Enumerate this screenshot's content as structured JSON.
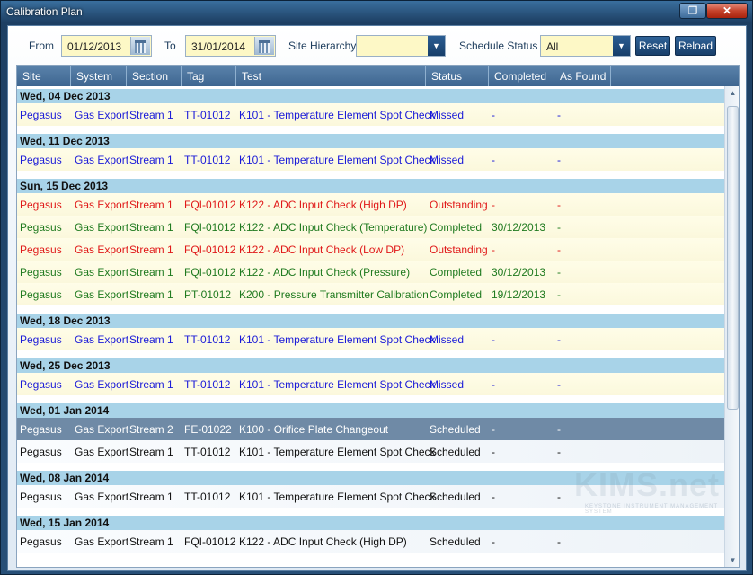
{
  "window": {
    "title": "Calibration Plan"
  },
  "filters": {
    "from_label": "From",
    "from_value": "01/12/2013",
    "to_label": "To",
    "to_value": "31/01/2014",
    "hierarchy_label": "Site Hierarchy",
    "hierarchy_value": "",
    "status_label": "Schedule Status",
    "status_value": "All",
    "reset_label": "Reset",
    "reload_label": "Reload"
  },
  "grid": {
    "columns": [
      "Site",
      "System",
      "Section",
      "Tag",
      "Test",
      "Status",
      "Completed",
      "As Found"
    ],
    "groups": [
      {
        "header": "Wed, 04 Dec 2013",
        "rows": [
          {
            "site": "Pegasus",
            "system": "Gas Export",
            "section": "Stream 1",
            "tag": "TT-01012",
            "test": "K101 - Temperature Element Spot Check",
            "status": "Missed",
            "completed": "-",
            "as_found": "-",
            "color": "#1a1ad8"
          }
        ]
      },
      {
        "header": "Wed, 11 Dec 2013",
        "rows": [
          {
            "site": "Pegasus",
            "system": "Gas Export",
            "section": "Stream 1",
            "tag": "TT-01012",
            "test": "K101 - Temperature Element Spot Check",
            "status": "Missed",
            "completed": "-",
            "as_found": "-",
            "color": "#1a1ad8"
          }
        ]
      },
      {
        "header": "Sun, 15 Dec 2013",
        "rows": [
          {
            "site": "Pegasus",
            "system": "Gas Export",
            "section": "Stream 1",
            "tag": "FQI-01012",
            "test": "K122 - ADC Input Check (High DP)",
            "status": "Outstanding",
            "completed": "-",
            "as_found": "-",
            "color": "#e01818"
          },
          {
            "site": "Pegasus",
            "system": "Gas Export",
            "section": "Stream 1",
            "tag": "FQI-01012",
            "test": "K122 - ADC Input Check (Temperature)",
            "status": "Completed",
            "completed": "30/12/2013",
            "as_found": "-",
            "color": "#1f7a1f"
          },
          {
            "site": "Pegasus",
            "system": "Gas Export",
            "section": "Stream 1",
            "tag": "FQI-01012",
            "test": "K122 - ADC Input Check (Low DP)",
            "status": "Outstanding",
            "completed": "-",
            "as_found": "-",
            "color": "#e01818"
          },
          {
            "site": "Pegasus",
            "system": "Gas Export",
            "section": "Stream 1",
            "tag": "FQI-01012",
            "test": "K122 - ADC Input Check (Pressure)",
            "status": "Completed",
            "completed": "30/12/2013",
            "as_found": "-",
            "color": "#1f7a1f"
          },
          {
            "site": "Pegasus",
            "system": "Gas Export",
            "section": "Stream 1",
            "tag": "PT-01012",
            "test": "K200 - Pressure Transmitter Calibration",
            "status": "Completed",
            "completed": "19/12/2013",
            "as_found": "-",
            "color": "#1f7a1f"
          }
        ]
      },
      {
        "header": "Wed, 18 Dec 2013",
        "rows": [
          {
            "site": "Pegasus",
            "system": "Gas Export",
            "section": "Stream 1",
            "tag": "TT-01012",
            "test": "K101 - Temperature Element Spot Check",
            "status": "Missed",
            "completed": "-",
            "as_found": "-",
            "color": "#1a1ad8"
          }
        ]
      },
      {
        "header": "Wed, 25 Dec 2013",
        "rows": [
          {
            "site": "Pegasus",
            "system": "Gas Export",
            "section": "Stream 1",
            "tag": "TT-01012",
            "test": "K101 - Temperature Element Spot Check",
            "status": "Missed",
            "completed": "-",
            "as_found": "-",
            "color": "#1a1ad8"
          }
        ]
      },
      {
        "header": "Wed, 01 Jan 2014",
        "rows": [
          {
            "site": "Pegasus",
            "system": "Gas Export",
            "section": "Stream 2",
            "tag": "FE-01022",
            "test": "K100 - Orifice Plate Changeout",
            "status": "Scheduled",
            "completed": "-",
            "as_found": "-",
            "color": "#111111",
            "selected": true
          },
          {
            "site": "Pegasus",
            "system": "Gas Export",
            "section": "Stream 1",
            "tag": "TT-01012",
            "test": "K101 - Temperature Element Spot Check",
            "status": "Scheduled",
            "completed": "-",
            "as_found": "-",
            "color": "#111111"
          }
        ]
      },
      {
        "header": "Wed, 08 Jan 2014",
        "rows": [
          {
            "site": "Pegasus",
            "system": "Gas Export",
            "section": "Stream 1",
            "tag": "TT-01012",
            "test": "K101 - Temperature Element Spot Check",
            "status": "Scheduled",
            "completed": "-",
            "as_found": "-",
            "color": "#111111"
          }
        ]
      },
      {
        "header": "Wed, 15 Jan 2014",
        "rows": [
          {
            "site": "Pegasus",
            "system": "Gas Export",
            "section": "Stream 1",
            "tag": "FQI-01012",
            "test": "K122 - ADC Input Check (High DP)",
            "status": "Scheduled",
            "completed": "-",
            "as_found": "-",
            "color": "#111111"
          }
        ]
      }
    ]
  },
  "watermark": {
    "logo": "KIMS.net",
    "tagline": "KEYSTONE INSTRUMENT MANAGEMENT SYSTEM"
  },
  "colors": {
    "missed": "#1a1ad8",
    "outstanding": "#e01818",
    "completed": "#1f7a1f",
    "scheduled": "#111111",
    "selection": "#6f8aa6",
    "group_header": "#a8d3e8"
  }
}
